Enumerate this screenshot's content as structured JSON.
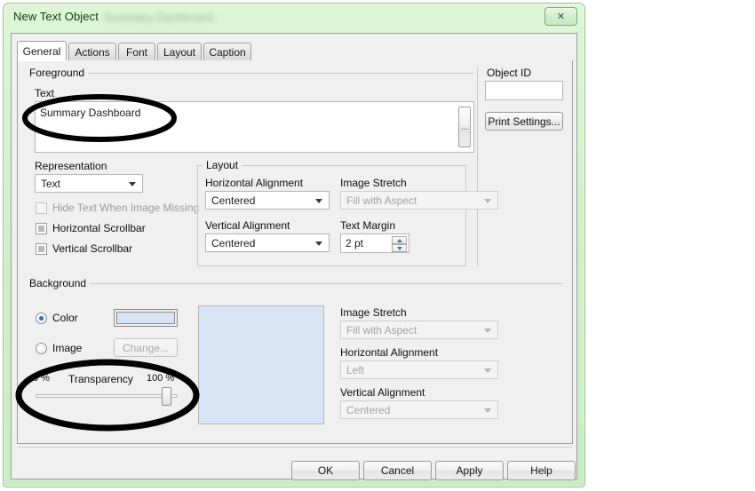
{
  "window": {
    "title": "New Text Object",
    "ghost_title": "Summary Dashboard",
    "close_label": "✕"
  },
  "tabs": [
    {
      "label": "General",
      "active": true
    },
    {
      "label": "Actions",
      "active": false
    },
    {
      "label": "Font",
      "active": false
    },
    {
      "label": "Layout",
      "active": false
    },
    {
      "label": "Caption",
      "active": false
    }
  ],
  "foreground": {
    "group_label": "Foreground",
    "text_label": "Text",
    "text_value": "Summary Dashboard",
    "ellipsis_label": "...",
    "representation_label": "Representation",
    "representation_value": "Text",
    "checkboxes": [
      {
        "label": "Hide Text When Image Missing",
        "checked": false,
        "disabled": true
      },
      {
        "label": "Horizontal Scrollbar",
        "checked": true,
        "disabled": false
      },
      {
        "label": "Vertical Scrollbar",
        "checked": true,
        "disabled": false
      }
    ]
  },
  "object_id": {
    "label": "Object ID",
    "value": "",
    "print_settings_label": "Print Settings..."
  },
  "layout": {
    "group_label": "Layout",
    "horizontal_alignment_label": "Horizontal Alignment",
    "horizontal_alignment_value": "Centered",
    "vertical_alignment_label": "Vertical Alignment",
    "vertical_alignment_value": "Centered",
    "image_stretch_label": "Image Stretch",
    "image_stretch_value": "Fill with Aspect",
    "text_margin_label": "Text Margin",
    "text_margin_value": "2 pt"
  },
  "background": {
    "group_label": "Background",
    "color_radio_label": "Color",
    "image_radio_label": "Image",
    "change_button_label": "Change...",
    "color_swatch_hex": "#d7e5f4",
    "preview_hex": "#d7e5f4",
    "transparency_label": "Transparency",
    "transparency_min_label": "0 %",
    "transparency_max_label": "100 %",
    "transparency_value": 100,
    "image_stretch_label": "Image Stretch",
    "image_stretch_value": "Fill with Aspect",
    "horizontal_alignment_label": "Horizontal Alignment",
    "horizontal_alignment_value": "Left",
    "vertical_alignment_label": "Vertical Alignment",
    "vertical_alignment_value": "Centered"
  },
  "footer": {
    "ok_label": "OK",
    "cancel_label": "Cancel",
    "apply_label": "Apply",
    "help_label": "Help"
  },
  "annotations": [
    {
      "name": "ellipse-around-text-value"
    },
    {
      "name": "ellipse-around-transparency-slider"
    }
  ]
}
